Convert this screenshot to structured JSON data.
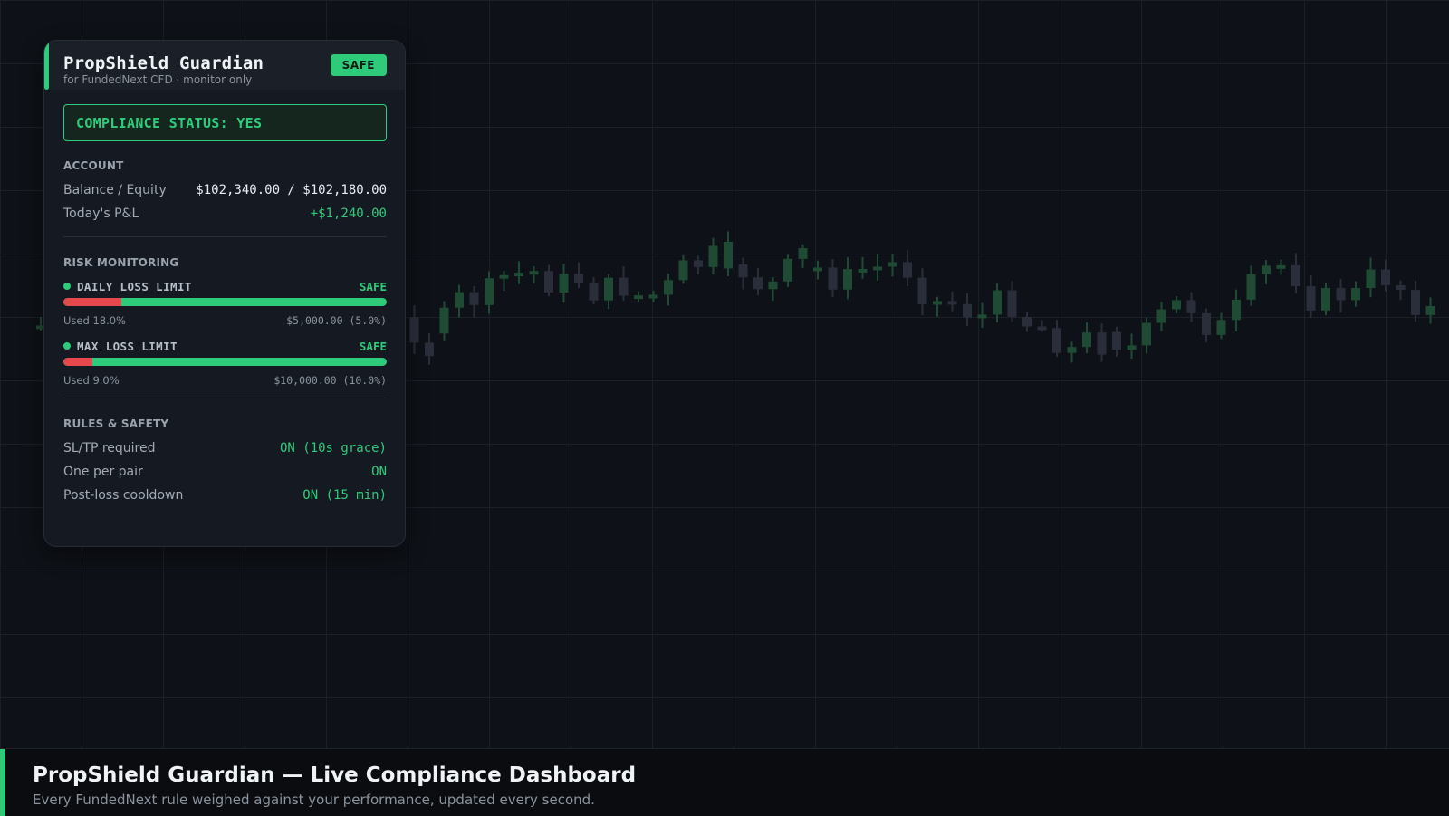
{
  "widget": {
    "title": "PropShield Guardian",
    "subtitle": "for FundedNext CFD · monitor only",
    "badge": "SAFE",
    "compliance": "COMPLIANCE STATUS: YES",
    "account": {
      "label": "ACCOUNT",
      "balance_label": "Balance / Equity",
      "balance_value": "$102,340.00 / $102,180.00",
      "pnl_label": "Today's P&L",
      "pnl_value": "+$1,240.00"
    },
    "risk": {
      "label": "RISK MONITORING",
      "limits": [
        {
          "name": "DAILY LOSS LIMIT",
          "status": "SAFE",
          "used_text": "Used 18.0%",
          "used_fraction": 0.18,
          "limit_text": "$5,000.00 (5.0%)"
        },
        {
          "name": "MAX LOSS LIMIT",
          "status": "SAFE",
          "used_text": "Used 9.0%",
          "used_fraction": 0.09,
          "limit_text": "$10,000.00 (10.0%)"
        }
      ]
    },
    "rules": {
      "label": "RULES & SAFETY",
      "items": [
        {
          "label": "SL/TP required",
          "value": "ON (10s grace)"
        },
        {
          "label": "One per pair",
          "value": "ON"
        },
        {
          "label": "Post-loss cooldown",
          "value": "ON (15 min)"
        }
      ]
    }
  },
  "caption": {
    "title": "PropShield Guardian — Live Compliance Dashboard",
    "subtitle": "Every FundedNext rule weighed against your performance, updated every second."
  },
  "colors": {
    "background": "#0e1117",
    "panel": "#151a22",
    "accent_green": "#2ecc7a",
    "danger_red": "#e5484d",
    "candle_up": "#1f4a33",
    "candle_down": "#2a2e3a"
  }
}
